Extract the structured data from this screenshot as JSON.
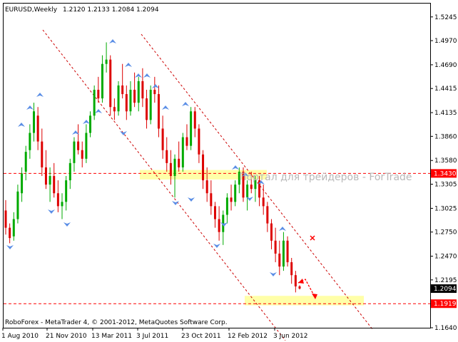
{
  "chart_data": {
    "type": "candlestick",
    "title": "EURUSD,Weekly",
    "ohlc_header": "1.2120 1.2133 1.2084 1.2094",
    "footer": "RoboForex - MetaTrader 4, © 2001-2012, MetaQuotes Software Corp.",
    "watermark": "Портал для трейдеров - ForTrade",
    "ylim": [
      1.164,
      1.54
    ],
    "y_ticks": [
      "1.5245",
      "1.4970",
      "1.4690",
      "1.4415",
      "1.4135",
      "1.3860",
      "1.3580",
      "1.3305",
      "1.3025",
      "1.2750",
      "1.2470",
      "1.2195",
      "1.1640"
    ],
    "x_ticks": [
      "1 Aug 2010",
      "21 Nov 2010",
      "13 Mar 2011",
      "3 Jul 2011",
      "23 Oct 2011",
      "12 Feb 2012",
      "3 Jun 2012"
    ],
    "current_price": "1.2094",
    "levels": [
      {
        "price": "1.3430",
        "value": 1.343,
        "color": "#ff0000"
      },
      {
        "price": "1.1919",
        "value": 1.1919,
        "color": "#ff0000"
      }
    ],
    "zones": [
      {
        "from": 1.336,
        "to": 1.347
      },
      {
        "from": 1.19,
        "to": 1.201
      }
    ],
    "candles": [
      {
        "o": 1.3,
        "h": 1.312,
        "l": 1.272,
        "c": 1.28
      },
      {
        "o": 1.28,
        "h": 1.285,
        "l": 1.262,
        "c": 1.268
      },
      {
        "o": 1.27,
        "h": 1.298,
        "l": 1.265,
        "c": 1.29
      },
      {
        "o": 1.29,
        "h": 1.33,
        "l": 1.285,
        "c": 1.322
      },
      {
        "o": 1.32,
        "h": 1.35,
        "l": 1.31,
        "c": 1.343
      },
      {
        "o": 1.345,
        "h": 1.375,
        "l": 1.335,
        "c": 1.368
      },
      {
        "o": 1.37,
        "h": 1.4,
        "l": 1.36,
        "c": 1.39
      },
      {
        "o": 1.39,
        "h": 1.425,
        "l": 1.38,
        "c": 1.415
      },
      {
        "o": 1.41,
        "h": 1.42,
        "l": 1.37,
        "c": 1.38
      },
      {
        "o": 1.38,
        "h": 1.395,
        "l": 1.34,
        "c": 1.35
      },
      {
        "o": 1.35,
        "h": 1.37,
        "l": 1.325,
        "c": 1.33
      },
      {
        "o": 1.33,
        "h": 1.35,
        "l": 1.31,
        "c": 1.34
      },
      {
        "o": 1.34,
        "h": 1.355,
        "l": 1.315,
        "c": 1.32
      },
      {
        "o": 1.32,
        "h": 1.335,
        "l": 1.298,
        "c": 1.305
      },
      {
        "o": 1.305,
        "h": 1.32,
        "l": 1.29,
        "c": 1.31
      },
      {
        "o": 1.31,
        "h": 1.34,
        "l": 1.3,
        "c": 1.335
      },
      {
        "o": 1.335,
        "h": 1.36,
        "l": 1.325,
        "c": 1.355
      },
      {
        "o": 1.355,
        "h": 1.385,
        "l": 1.345,
        "c": 1.38
      },
      {
        "o": 1.38,
        "h": 1.4,
        "l": 1.365,
        "c": 1.37
      },
      {
        "o": 1.37,
        "h": 1.38,
        "l": 1.35,
        "c": 1.36
      },
      {
        "o": 1.36,
        "h": 1.4,
        "l": 1.355,
        "c": 1.39
      },
      {
        "o": 1.39,
        "h": 1.415,
        "l": 1.385,
        "c": 1.41
      },
      {
        "o": 1.41,
        "h": 1.445,
        "l": 1.405,
        "c": 1.44
      },
      {
        "o": 1.44,
        "h": 1.455,
        "l": 1.425,
        "c": 1.43
      },
      {
        "o": 1.43,
        "h": 1.48,
        "l": 1.425,
        "c": 1.47
      },
      {
        "o": 1.47,
        "h": 1.495,
        "l": 1.46,
        "c": 1.475
      },
      {
        "o": 1.475,
        "h": 1.48,
        "l": 1.41,
        "c": 1.42
      },
      {
        "o": 1.42,
        "h": 1.43,
        "l": 1.405,
        "c": 1.415
      },
      {
        "o": 1.415,
        "h": 1.45,
        "l": 1.41,
        "c": 1.445
      },
      {
        "o": 1.445,
        "h": 1.47,
        "l": 1.43,
        "c": 1.435
      },
      {
        "o": 1.435,
        "h": 1.445,
        "l": 1.405,
        "c": 1.415
      },
      {
        "o": 1.415,
        "h": 1.45,
        "l": 1.41,
        "c": 1.44
      },
      {
        "o": 1.44,
        "h": 1.46,
        "l": 1.42,
        "c": 1.425
      },
      {
        "o": 1.425,
        "h": 1.455,
        "l": 1.415,
        "c": 1.45
      },
      {
        "o": 1.45,
        "h": 1.465,
        "l": 1.42,
        "c": 1.43
      },
      {
        "o": 1.43,
        "h": 1.44,
        "l": 1.395,
        "c": 1.405
      },
      {
        "o": 1.405,
        "h": 1.445,
        "l": 1.4,
        "c": 1.44
      },
      {
        "o": 1.44,
        "h": 1.455,
        "l": 1.425,
        "c": 1.435
      },
      {
        "o": 1.435,
        "h": 1.445,
        "l": 1.385,
        "c": 1.395
      },
      {
        "o": 1.395,
        "h": 1.41,
        "l": 1.36,
        "c": 1.37
      },
      {
        "o": 1.37,
        "h": 1.385,
        "l": 1.345,
        "c": 1.355
      },
      {
        "o": 1.355,
        "h": 1.37,
        "l": 1.33,
        "c": 1.34
      },
      {
        "o": 1.34,
        "h": 1.365,
        "l": 1.315,
        "c": 1.36
      },
      {
        "o": 1.36,
        "h": 1.38,
        "l": 1.345,
        "c": 1.35
      },
      {
        "o": 1.35,
        "h": 1.39,
        "l": 1.345,
        "c": 1.385
      },
      {
        "o": 1.385,
        "h": 1.4,
        "l": 1.37,
        "c": 1.375
      },
      {
        "o": 1.375,
        "h": 1.42,
        "l": 1.37,
        "c": 1.415
      },
      {
        "o": 1.415,
        "h": 1.42,
        "l": 1.385,
        "c": 1.395
      },
      {
        "o": 1.395,
        "h": 1.4,
        "l": 1.355,
        "c": 1.365
      },
      {
        "o": 1.365,
        "h": 1.37,
        "l": 1.325,
        "c": 1.335
      },
      {
        "o": 1.335,
        "h": 1.35,
        "l": 1.31,
        "c": 1.32
      },
      {
        "o": 1.32,
        "h": 1.335,
        "l": 1.295,
        "c": 1.305
      },
      {
        "o": 1.305,
        "h": 1.31,
        "l": 1.28,
        "c": 1.29
      },
      {
        "o": 1.29,
        "h": 1.305,
        "l": 1.265,
        "c": 1.275
      },
      {
        "o": 1.275,
        "h": 1.3,
        "l": 1.26,
        "c": 1.295
      },
      {
        "o": 1.295,
        "h": 1.32,
        "l": 1.285,
        "c": 1.315
      },
      {
        "o": 1.315,
        "h": 1.33,
        "l": 1.3,
        "c": 1.31
      },
      {
        "o": 1.31,
        "h": 1.335,
        "l": 1.305,
        "c": 1.33
      },
      {
        "o": 1.33,
        "h": 1.35,
        "l": 1.32,
        "c": 1.345
      },
      {
        "o": 1.345,
        "h": 1.35,
        "l": 1.31,
        "c": 1.315
      },
      {
        "o": 1.315,
        "h": 1.335,
        "l": 1.3,
        "c": 1.33
      },
      {
        "o": 1.33,
        "h": 1.345,
        "l": 1.32,
        "c": 1.325
      },
      {
        "o": 1.325,
        "h": 1.34,
        "l": 1.31,
        "c": 1.335
      },
      {
        "o": 1.335,
        "h": 1.34,
        "l": 1.305,
        "c": 1.315
      },
      {
        "o": 1.315,
        "h": 1.33,
        "l": 1.295,
        "c": 1.305
      },
      {
        "o": 1.305,
        "h": 1.31,
        "l": 1.275,
        "c": 1.285
      },
      {
        "o": 1.285,
        "h": 1.29,
        "l": 1.255,
        "c": 1.265
      },
      {
        "o": 1.265,
        "h": 1.28,
        "l": 1.24,
        "c": 1.25
      },
      {
        "o": 1.25,
        "h": 1.265,
        "l": 1.225,
        "c": 1.235
      },
      {
        "o": 1.235,
        "h": 1.275,
        "l": 1.23,
        "c": 1.265
      },
      {
        "o": 1.265,
        "h": 1.27,
        "l": 1.235,
        "c": 1.24
      },
      {
        "o": 1.24,
        "h": 1.245,
        "l": 1.215,
        "c": 1.225
      },
      {
        "o": 1.225,
        "h": 1.23,
        "l": 1.205,
        "c": 1.212
      },
      {
        "o": 1.212,
        "h": 1.2133,
        "l": 1.2084,
        "c": 1.2094
      }
    ]
  }
}
